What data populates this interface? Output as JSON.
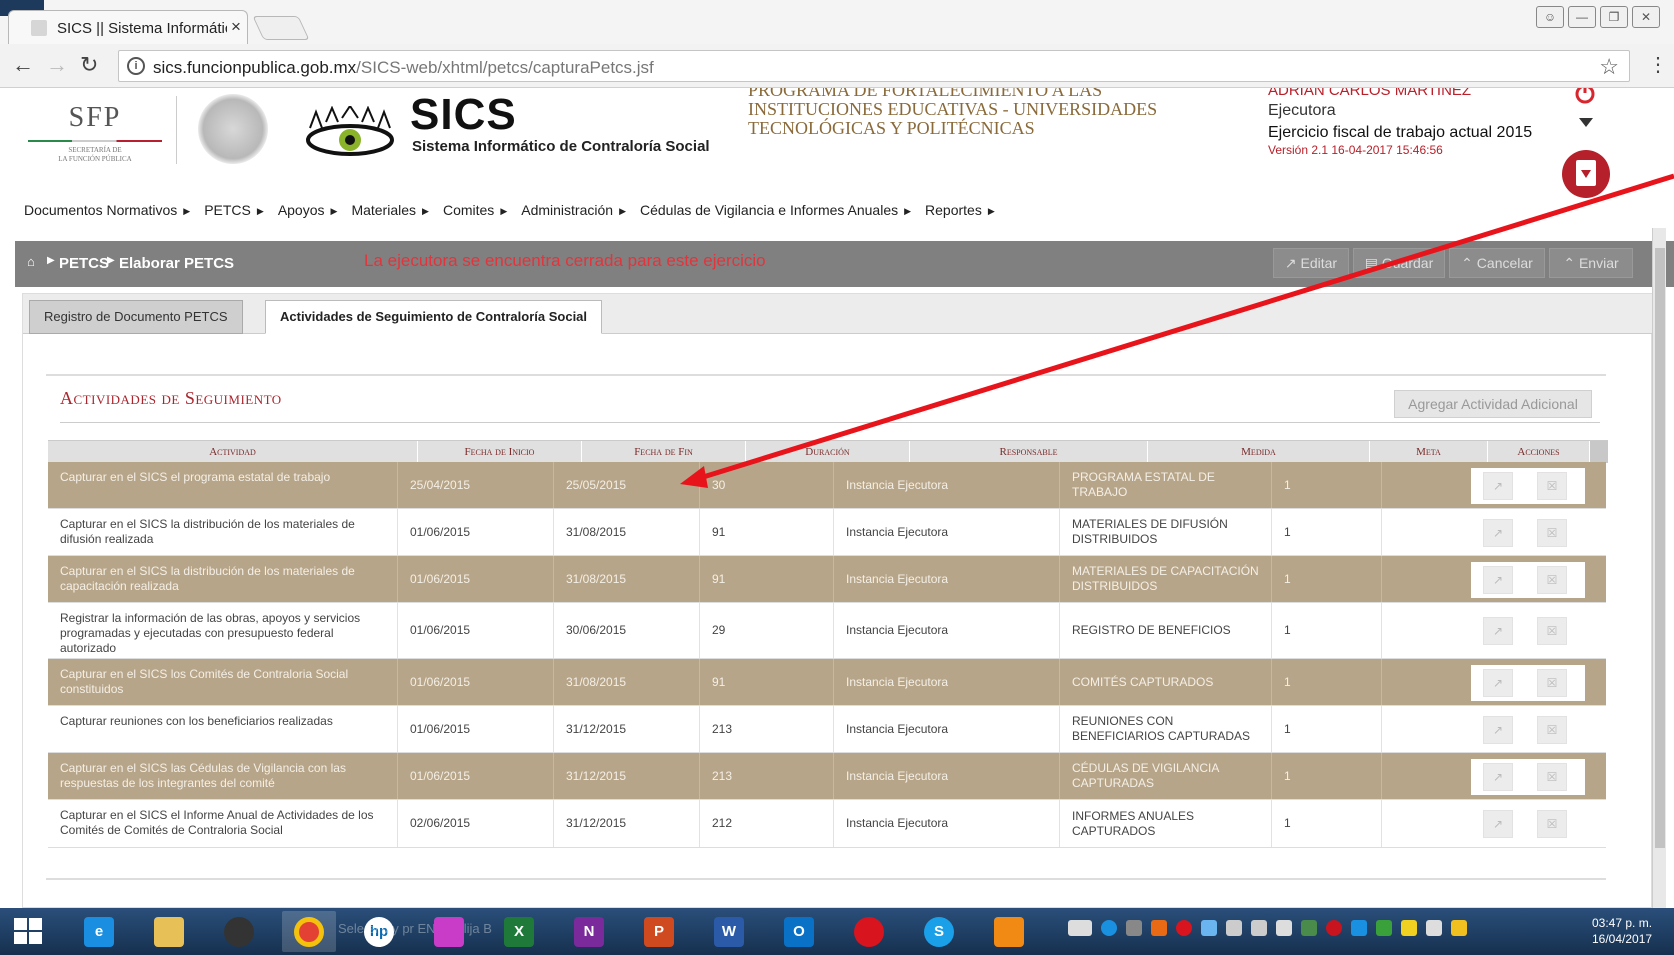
{
  "browser": {
    "tab_title": "SICS || Sistema Informátic",
    "tab_close": "×",
    "url_host": "sics.funcionpublica.gob.mx",
    "url_path": "/SICS-web/xhtml/petcs/capturaPetcs.jsf"
  },
  "header": {
    "sfp_logo": "SFP",
    "sfp_sub1": "SECRETARÍA DE",
    "sfp_sub2": "LA FUNCIÓN PÚBLICA",
    "sics_title": "SICS",
    "sics_subtitle": "Sistema Informático de Contraloría Social",
    "programa_line1": "PROGRAMA DE FORTALECIMIENTO A LAS",
    "programa_line2": "INSTITUCIONES EDUCATIVAS - UNIVERSIDADES",
    "programa_line3": "TECNOLÓGICAS Y POLITÉCNICAS",
    "user_name": "ADRIAN CARLOS MARTINEZ",
    "user_role": "Ejecutora",
    "fiscal": "Ejercicio fiscal de trabajo actual  2015",
    "version": "Versión 2.1   16-04-2017 15:46:56"
  },
  "menu": [
    "Documentos Normativos",
    "PETCS",
    "Apoyos",
    "Materiales",
    "Comites",
    "Administración",
    "Cédulas de Vigilancia e Informes Anuales",
    "Reportes"
  ],
  "breadcrumb": {
    "item1": "PETCS",
    "item2": "Elaborar PETCS",
    "notice": "La ejecutora se encuentra cerrada para este ejercicio",
    "btn_editar": "Editar",
    "btn_guardar": "Guardar",
    "btn_cancelar": "Cancelar",
    "btn_enviar": "Enviar"
  },
  "tabs": {
    "tab1": "Registro de Documento PETCS",
    "tab2": "Actividades de Seguimiento de Contraloría Social"
  },
  "section": {
    "title": "Actividades de Seguimiento",
    "add_button": "Agregar Actividad Adicional"
  },
  "table": {
    "headers": [
      "Actividad",
      "Fecha de Inicio",
      "Fecha de Fin",
      "Duración",
      "Responsable",
      "Medida",
      "Meta",
      "Acciones"
    ],
    "rows": [
      {
        "actividad": "Capturar en el SICS el programa estatal de trabajo",
        "inicio": "25/04/2015",
        "fin": "25/05/2015",
        "duracion": "30",
        "responsable": "Instancia Ejecutora",
        "medida": "PROGRAMA ESTATAL DE TRABAJO",
        "meta": "1"
      },
      {
        "actividad": "Capturar en el SICS la distribución de los materiales de difusión realizada",
        "inicio": "01/06/2015",
        "fin": "31/08/2015",
        "duracion": "91",
        "responsable": "Instancia Ejecutora",
        "medida": "MATERIALES DE DIFUSIÓN DISTRIBUIDOS",
        "meta": "1"
      },
      {
        "actividad": "Capturar en el SICS la distribución de los materiales de capacitación realizada",
        "inicio": "01/06/2015",
        "fin": "31/08/2015",
        "duracion": "91",
        "responsable": "Instancia Ejecutora",
        "medida": "MATERIALES DE CAPACITACIÓN DISTRIBUIDOS",
        "meta": "1"
      },
      {
        "actividad": "Registrar la información de las obras, apoyos y servicios programadas y ejecutadas con presupuesto federal autorizado",
        "inicio": "01/06/2015",
        "fin": "30/06/2015",
        "duracion": "29",
        "responsable": "Instancia Ejecutora",
        "medida": "REGISTRO DE BENEFICIOS",
        "meta": "1"
      },
      {
        "actividad": "Capturar en el SICS los Comités de Contraloria Social constituidos",
        "inicio": "01/06/2015",
        "fin": "31/08/2015",
        "duracion": "91",
        "responsable": "Instancia Ejecutora",
        "medida": "COMITÉS CAPTURADOS",
        "meta": "1"
      },
      {
        "actividad": "Capturar reuniones con los beneficiarios realizadas",
        "inicio": "01/06/2015",
        "fin": "31/12/2015",
        "duracion": "213",
        "responsable": "Instancia Ejecutora",
        "medida": "REUNIONES CON BENEFICIARIOS CAPTURADAS",
        "meta": "1"
      },
      {
        "actividad": "Capturar en el SICS las Cédulas de Vigilancia con las respuestas de los integrantes del comité",
        "inicio": "01/06/2015",
        "fin": "31/12/2015",
        "duracion": "213",
        "responsable": "Instancia Ejecutora",
        "medida": "CÉDULAS DE VIGILANCIA CAPTURADAS",
        "meta": "1"
      },
      {
        "actividad": "Capturar en el SICS el Informe Anual de Actividades de los Comités de Comités de Contraloria Social",
        "inicio": "02/06/2015",
        "fin": "31/12/2015",
        "duracion": "212",
        "responsable": "Instancia Ejecutora",
        "medida": "INFORMES ANUALES CAPTURADOS",
        "meta": "1"
      }
    ]
  },
  "taskbar": {
    "status_text": "Sele            el d          y pr           ENTR     elija B",
    "clock_time": "03:47 p. m.",
    "clock_date": "16/04/2017"
  },
  "colors": {
    "odd_row": "#b7a589",
    "accent_red": "#b8202a",
    "arrow": "#e8141c"
  }
}
